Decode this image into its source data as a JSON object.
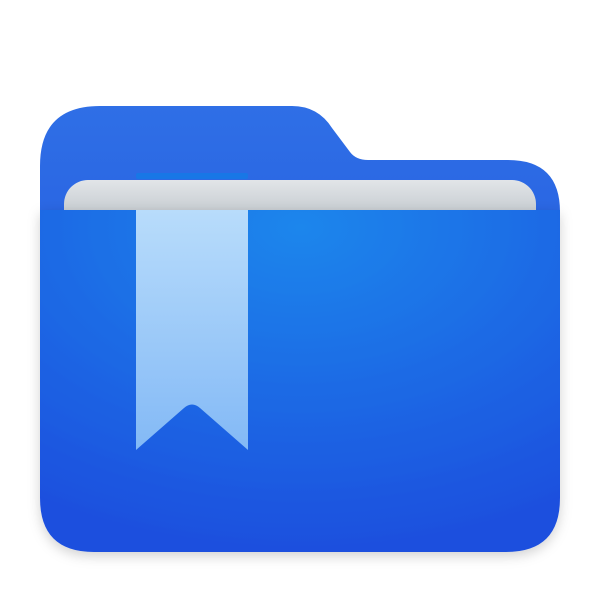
{
  "icon": {
    "semantic": "folder-bookmark-icon",
    "colors": {
      "background": "#ffffff",
      "folder_back_top": "#2f6fe6",
      "folder_back_bottom": "#1f52dc",
      "folder_front_center": "#1f86ec",
      "folder_front_edge": "#1b4fde",
      "paper_top": "#e2e5e8",
      "paper_bottom": "#a7b0b6",
      "ribbon_top": "#b8dcfb",
      "ribbon_bottom": "#83b9f6",
      "ribbon_stripe": "#1877e6"
    }
  }
}
